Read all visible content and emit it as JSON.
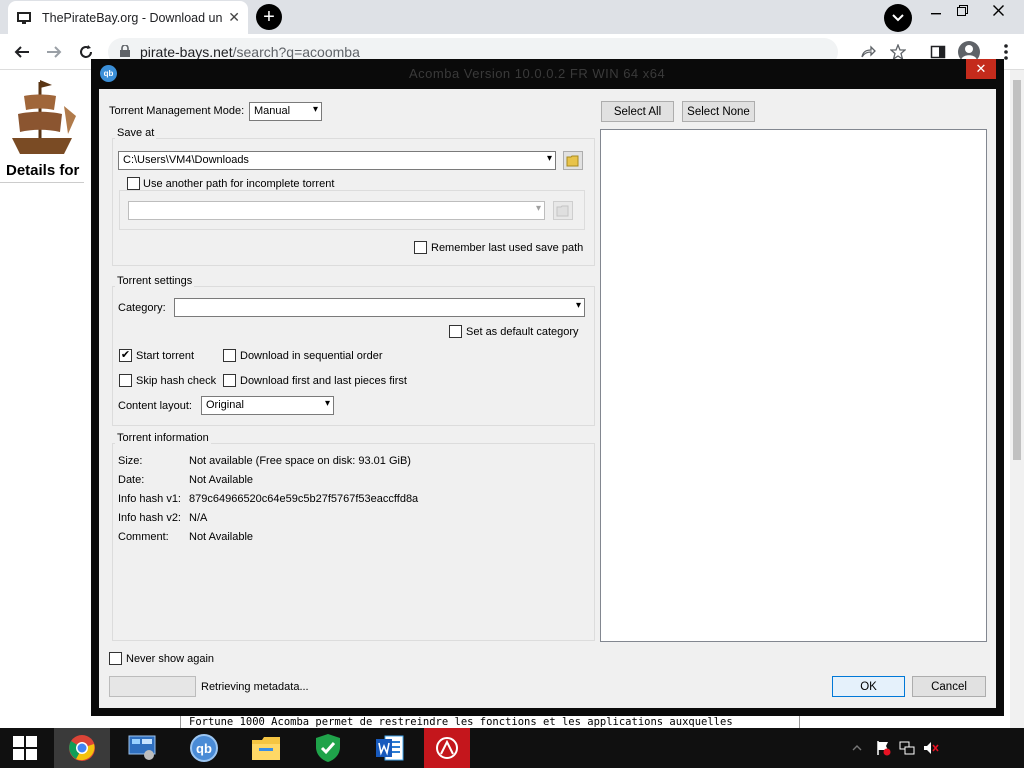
{
  "browser": {
    "tab_title": "ThePirateBay.org - Download unl",
    "url_host": "pirate-bays.net",
    "url_path": "/search?q=acoomba",
    "new_tab_symbol": "+",
    "close_tab_symbol": "✕"
  },
  "page": {
    "heading": "Details for",
    "body_text": "Fortune 1000 Acomba permet de restreindre les fonctions et les applications auxquelles"
  },
  "dialog": {
    "title": "Acomba Version 10.0.0.2 FR WIN 64 x64",
    "close_symbol": "✕",
    "management_mode_label": "Torrent Management Mode:",
    "management_mode_value": "Manual",
    "save_at": {
      "title": "Save at",
      "path": "C:\\Users\\VM4\\Downloads",
      "use_another_path_label": "Use another path for incomplete torrent",
      "incomplete_path": "",
      "remember_label": "Remember last used save path"
    },
    "torrent_settings": {
      "title": "Torrent settings",
      "category_label": "Category:",
      "category_value": "",
      "set_default_label": "Set as default category",
      "start_torrent_label": "Start torrent",
      "sequential_label": "Download in sequential order",
      "skip_hash_label": "Skip hash check",
      "first_last_label": "Download first and last pieces first",
      "content_layout_label": "Content layout:",
      "content_layout_value": "Original"
    },
    "torrent_info": {
      "title": "Torrent information",
      "rows": [
        {
          "label": "Size:",
          "value": "Not available (Free space on disk: 93.01 GiB)"
        },
        {
          "label": "Date:",
          "value": "Not Available"
        },
        {
          "label": "Info hash v1:",
          "value": "879c64966520c64e59c5b27f5767f53eaccffd8a"
        },
        {
          "label": "Info hash v2:",
          "value": "N/A"
        },
        {
          "label": "Comment:",
          "value": "Not Available"
        }
      ]
    },
    "select_all": "Select All",
    "select_none": "Select None",
    "never_show_label": "Never show again",
    "status_text": "Retrieving metadata...",
    "ok_label": "OK",
    "cancel_label": "Cancel",
    "check_symbol": "✔"
  },
  "taskbar": {
    "qb_text": "qb"
  }
}
